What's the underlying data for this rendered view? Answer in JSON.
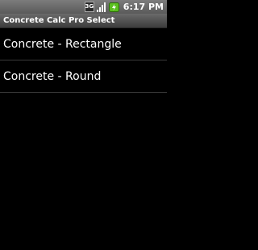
{
  "status_bar": {
    "network": "3G",
    "time": "6:17 PM",
    "icons": [
      "3g-icon",
      "signal-icon",
      "battery-charging-icon"
    ]
  },
  "title_bar": {
    "title": "Concrete Calc Pro Select"
  },
  "list": {
    "items": [
      {
        "label": "Concrete - Rectangle"
      },
      {
        "label": "Concrete - Round"
      }
    ]
  },
  "colors": {
    "background": "#000000",
    "text": "#ffffff",
    "divider": "#3a3a3a",
    "battery_charging": "#5bbf1f"
  }
}
